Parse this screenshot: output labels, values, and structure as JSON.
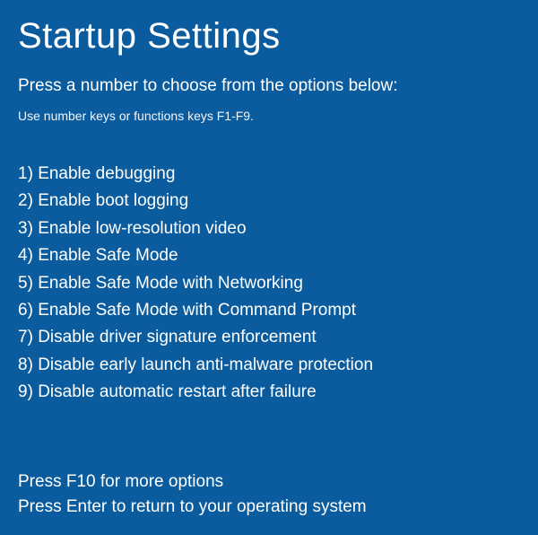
{
  "title": "Startup Settings",
  "subtitle": "Press a number to choose from the options below:",
  "hint": "Use number keys or functions keys F1-F9.",
  "options": [
    {
      "num": "1",
      "label": "Enable debugging"
    },
    {
      "num": "2",
      "label": "Enable boot logging"
    },
    {
      "num": "3",
      "label": "Enable low-resolution video"
    },
    {
      "num": "4",
      "label": "Enable Safe Mode"
    },
    {
      "num": "5",
      "label": "Enable Safe Mode with Networking"
    },
    {
      "num": "6",
      "label": "Enable Safe Mode with Command Prompt"
    },
    {
      "num": "7",
      "label": "Disable driver signature enforcement"
    },
    {
      "num": "8",
      "label": "Disable early launch anti-malware protection"
    },
    {
      "num": "9",
      "label": "Disable automatic restart after failure"
    }
  ],
  "footer": {
    "more": "Press F10 for more options",
    "return": "Press Enter to return to your operating system"
  }
}
